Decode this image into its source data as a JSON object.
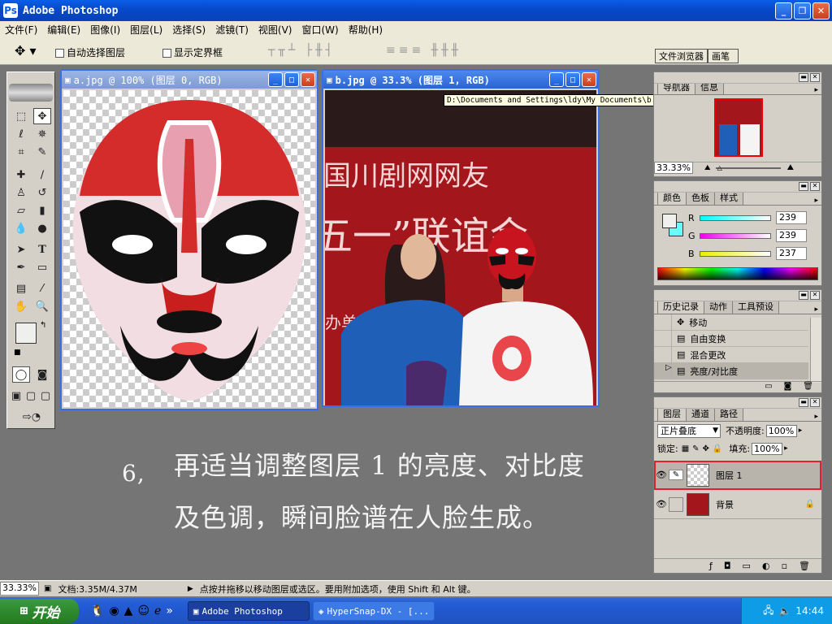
{
  "app": {
    "title": "Adobe Photoshop",
    "icon_text": "Ps"
  },
  "menu": [
    "文件(F)",
    "编辑(E)",
    "图像(I)",
    "图层(L)",
    "选择(S)",
    "滤镜(T)",
    "视图(V)",
    "窗口(W)",
    "帮助(H)"
  ],
  "options_bar": {
    "auto_select_label": "自动选择图层",
    "show_bounds_label": "显示定界框",
    "file_browser_tab": "文件浏览器",
    "brushes_tab": "画笔"
  },
  "doc_a": {
    "title": "a.jpg @ 100% (图层 0, RGB)"
  },
  "doc_b": {
    "title": "b.jpg @ 33.3% (图层 1, RGB)",
    "banner_line1": "国川剧网网友",
    "banner_line2": "五一”联谊会",
    "banner_small": "办单"
  },
  "tooltip": "D:\\Documents and Settings\\ldy\\My Documents\\b.jpg @ 33.3% (图层 1, RGB)",
  "navigator": {
    "tabs": [
      "导航器",
      "信息"
    ],
    "zoom": "33.33%"
  },
  "color_panel": {
    "tabs": [
      "颜色",
      "色板",
      "样式"
    ],
    "r_label": "R",
    "g_label": "G",
    "b_label": "B",
    "r": "239",
    "g": "239",
    "b": "237",
    "fg_color": "#efefed",
    "bg_color": "#66ffff"
  },
  "history": {
    "tabs": [
      "历史记录",
      "动作",
      "工具预设"
    ],
    "items": [
      "移动",
      "自由变换",
      "混合更改",
      "亮度/对比度"
    ]
  },
  "layers": {
    "tabs": [
      "图层",
      "通道",
      "路径"
    ],
    "blend_mode": "正片叠底",
    "opacity_label": "不透明度:",
    "opacity": "100%",
    "lock_label": "锁定:",
    "fill_label": "填充:",
    "fill": "100%",
    "items": [
      "图层 1",
      "背景"
    ]
  },
  "caption": {
    "step": "6,",
    "line1": "再适当调整图层 1 的亮度、对比度",
    "line2": "及色调，瞬间脸谱在人脸生成。"
  },
  "status": {
    "zoom": "33.33%",
    "doc_size": "文档:3.35M/4.37M",
    "hint": "点按并拖移以移动图层或选区。要用附加选项，使用 Shift 和 Alt 键。"
  },
  "taskbar": {
    "start": "开始",
    "tasks": [
      "Adobe Photoshop",
      "HyperSnap-DX - [..."
    ],
    "clock": "14:44"
  }
}
